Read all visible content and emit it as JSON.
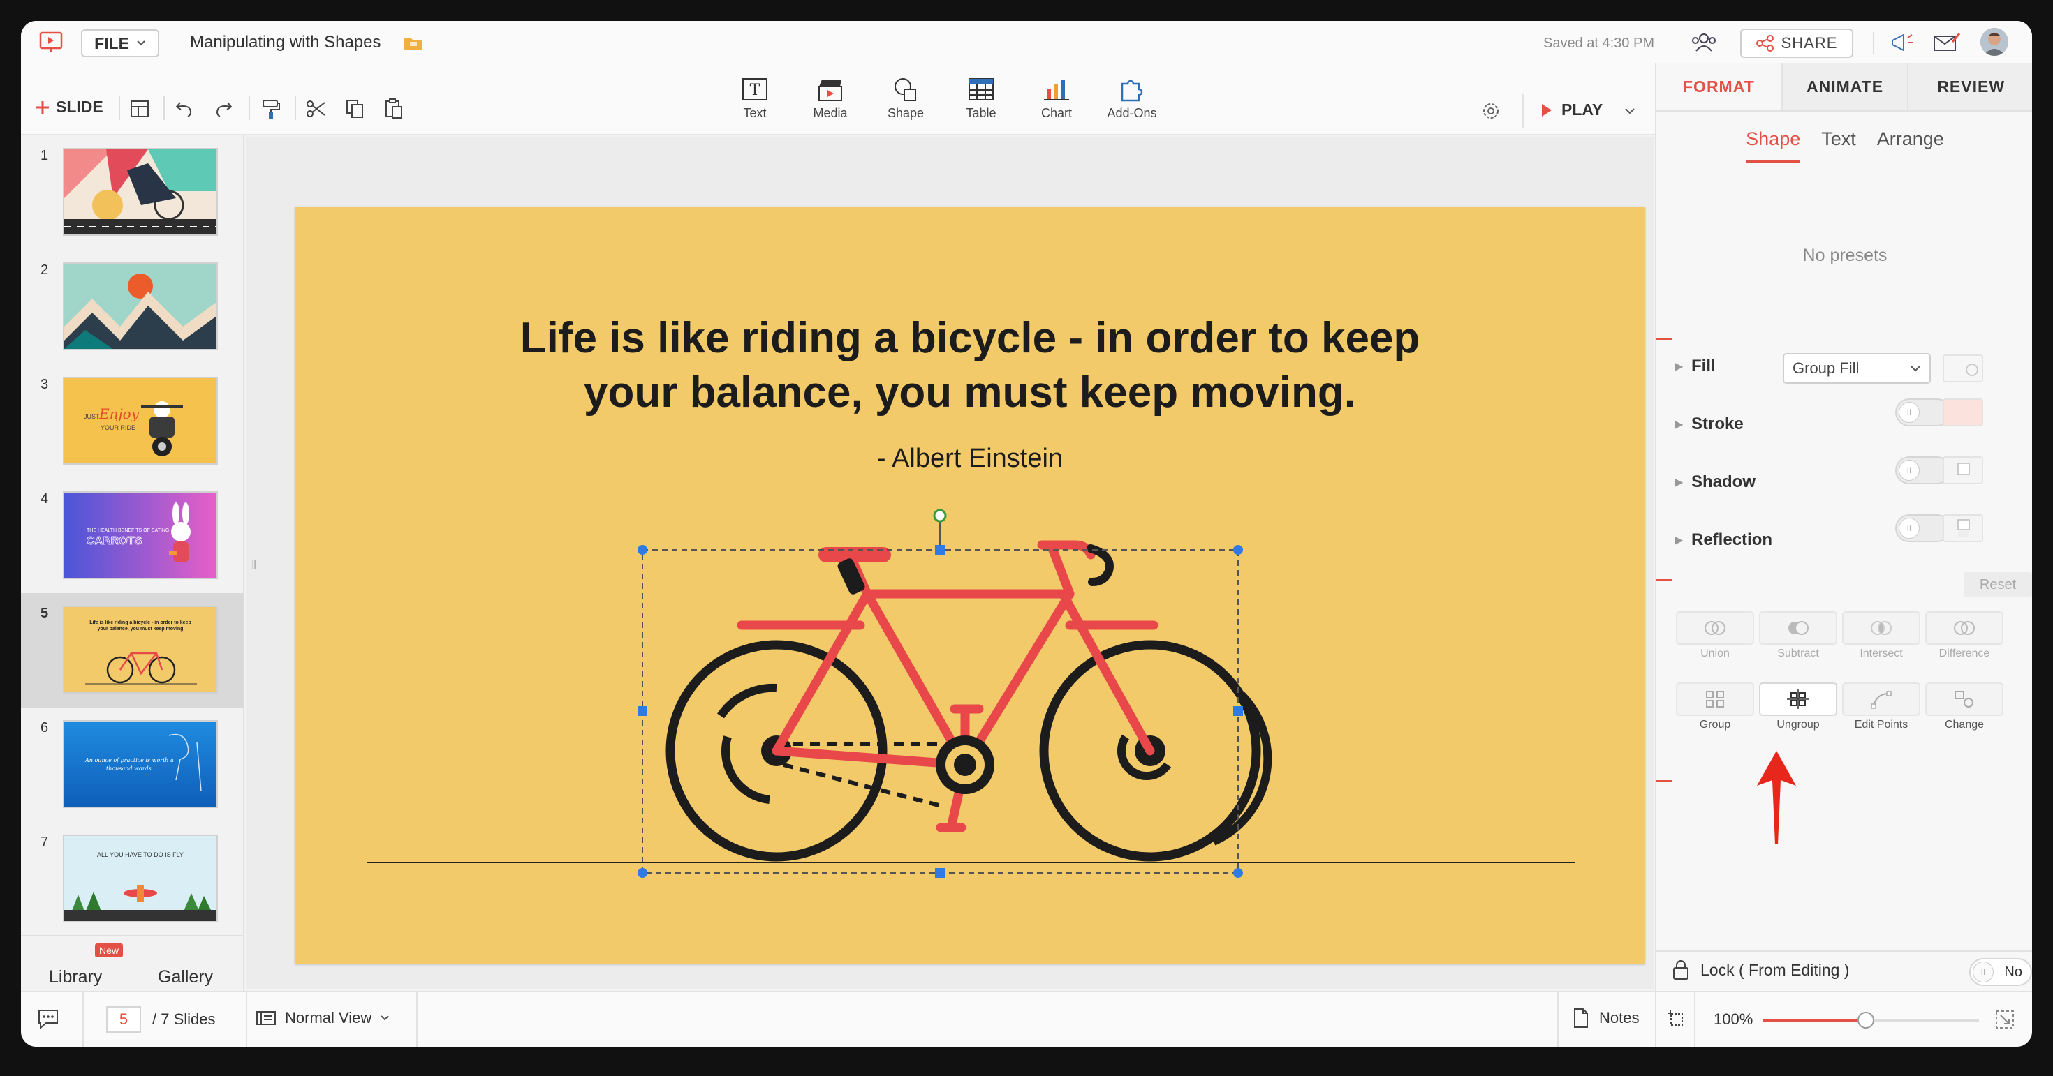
{
  "topbar": {
    "file_label": "FILE",
    "doc_title": "Manipulating with Shapes",
    "saved_status": "Saved at 4:30 PM",
    "share_label": "SHARE"
  },
  "toolbar": {
    "add_slide_label": "SLIDE",
    "insert_items": [
      "Text",
      "Media",
      "Shape",
      "Table",
      "Chart",
      "Add-Ons"
    ],
    "play_label": "PLAY"
  },
  "slides_panel": {
    "numbers": [
      "1",
      "2",
      "3",
      "4",
      "5",
      "6",
      "7"
    ],
    "active_index": 5,
    "library_label": "Library",
    "new_badge": "New",
    "gallery_label": "Gallery"
  },
  "slide": {
    "quote_line1": "Life is like riding a bicycle - in order to keep",
    "quote_line2": "your balance, you must keep moving.",
    "author": "- Albert Einstein",
    "background_color": "#F3CA6A",
    "bicycle_color": "#E8484A"
  },
  "thumb_text": {
    "s3_just": "JUST",
    "s3_enjoy": "Enjoy",
    "s3_ride": "YOUR RIDE",
    "s4_line": "THE HEALTH BENEFITS OF EATING",
    "s4_word": "CARROTS",
    "s5_line1": "Life is like riding a bicycle - in order to keep",
    "s5_line2": "your balance, you must keep moving",
    "s6_line1": "An ounce of practice is worth a",
    "s6_line2": "thousand words.",
    "s7_line1": "ALL YOU HAVE TO DO IS FLY"
  },
  "right_panel": {
    "tabs": [
      "FORMAT",
      "ANIMATE",
      "REVIEW"
    ],
    "subtabs": [
      "Shape",
      "Text",
      "Arrange"
    ],
    "no_presets": "No presets",
    "props": [
      "Fill",
      "Stroke",
      "Shadow",
      "Reflection"
    ],
    "fill_value": "Group Fill",
    "reset_label": "Reset",
    "ops_row1": [
      "Union",
      "Subtract",
      "Intersect",
      "Difference"
    ],
    "ops_row2": [
      "Group",
      "Ungroup",
      "Edit Points",
      "Change"
    ],
    "lock_label": "Lock ( From Editing )",
    "lock_value": "No",
    "accent_color": "#E55046"
  },
  "statusbar": {
    "current_page": "5",
    "total_pages": "/ 7 Slides",
    "view_label": "Normal View",
    "notes_label": "Notes",
    "zoom": "100%"
  }
}
